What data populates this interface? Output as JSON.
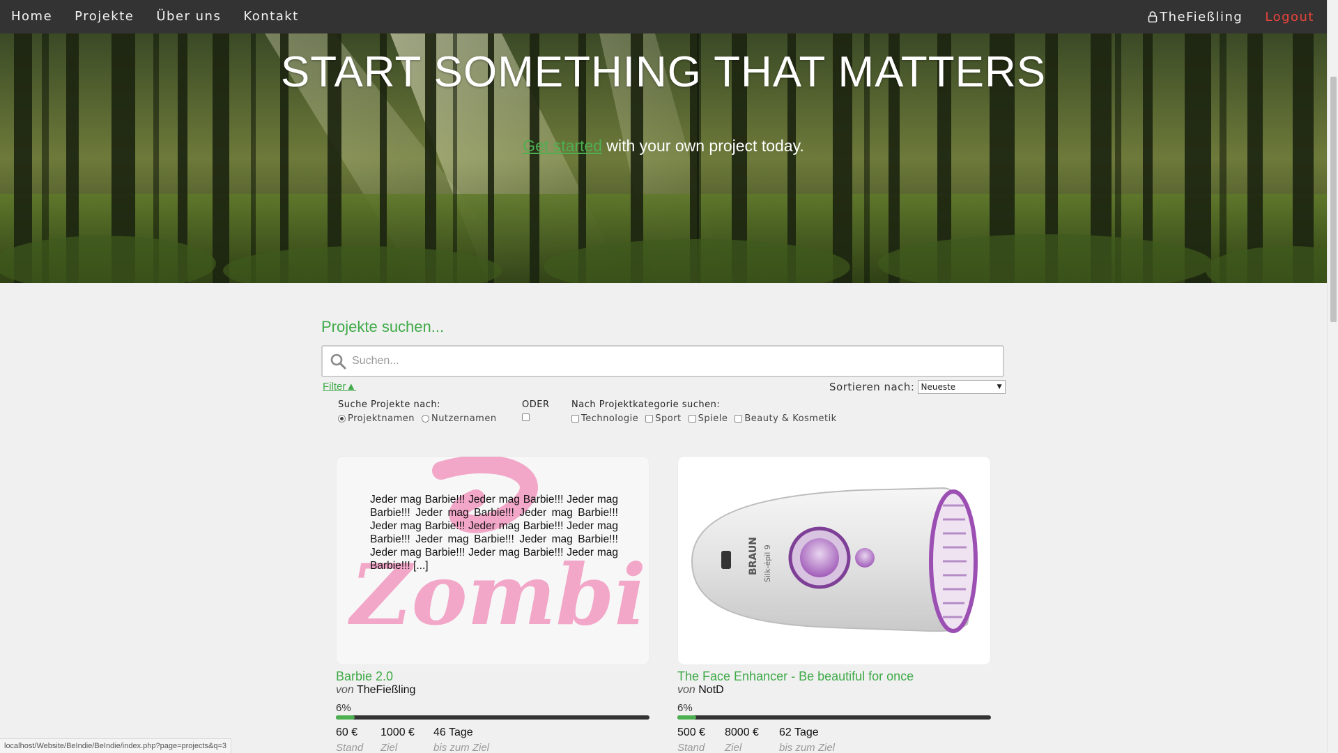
{
  "nav": {
    "links": [
      "Home",
      "Projekte",
      "Über uns",
      "Kontakt"
    ],
    "user": "TheFießling",
    "logout": "Logout"
  },
  "hero": {
    "title": "START SOMETHING THAT MATTERS",
    "cta_link": "Get started",
    "cta_rest": " with your own project today."
  },
  "search": {
    "title": "Projekte suchen...",
    "placeholder": "Suchen...",
    "filter_label": "Filter▲",
    "sort_label": "Sortieren nach:",
    "sort_value": "Neueste",
    "by_label": "Suche Projekte nach:",
    "by_options": [
      "Projektnamen",
      "Nutzernamen"
    ],
    "by_selected": "Projektnamen",
    "or_label": "ODER",
    "category_label": "Nach Projektkategorie suchen:",
    "categories": [
      "Technologie",
      "Sport",
      "Spiele",
      "Beauty & Kosmetik"
    ]
  },
  "projects": [
    {
      "title": "Barbie 2.0",
      "by_prefix": "von",
      "author": "TheFießling",
      "percent_label": "6%",
      "progress": 0.06,
      "raised": "60 €",
      "goal": "1000 €",
      "days": "46 Tage",
      "raised_label": "Stand",
      "goal_label": "Ziel",
      "days_label": "bis zum Ziel",
      "image_text": "Jeder mag Barbie!!! Jeder mag Barbie!!! Jeder mag Barbie!!! Jeder mag Barbie!!! Jeder mag Barbie!!! Jeder mag Barbie!!! Jeder mag Barbie!!! Jeder mag Barbie!!! Jeder mag Barbie!!! Jeder mag Barbie!!! Jeder mag Barbie!!! Jeder mag Barbie!!! Jeder mag Barbie!!! [...]",
      "image_logo": "Zombie"
    },
    {
      "title": "The Face Enhancer - Be beautiful for once",
      "by_prefix": "von",
      "author": "NotD",
      "percent_label": "6%",
      "progress": 0.06,
      "raised": "500 €",
      "goal": "8000 €",
      "days": "62 Tage",
      "raised_label": "Stand",
      "goal_label": "Ziel",
      "days_label": "bis zum Ziel",
      "image_logo": "BRAUN",
      "image_model": "Silk-épil 9"
    }
  ],
  "status_url": "localhost/Website/BeIndie/BeIndie/index.php?page=projects&q=3",
  "colors": {
    "accent": "#3faa48",
    "nav_bg": "#333333",
    "logout": "#e8443b",
    "page_bg": "#f0f0f0"
  }
}
